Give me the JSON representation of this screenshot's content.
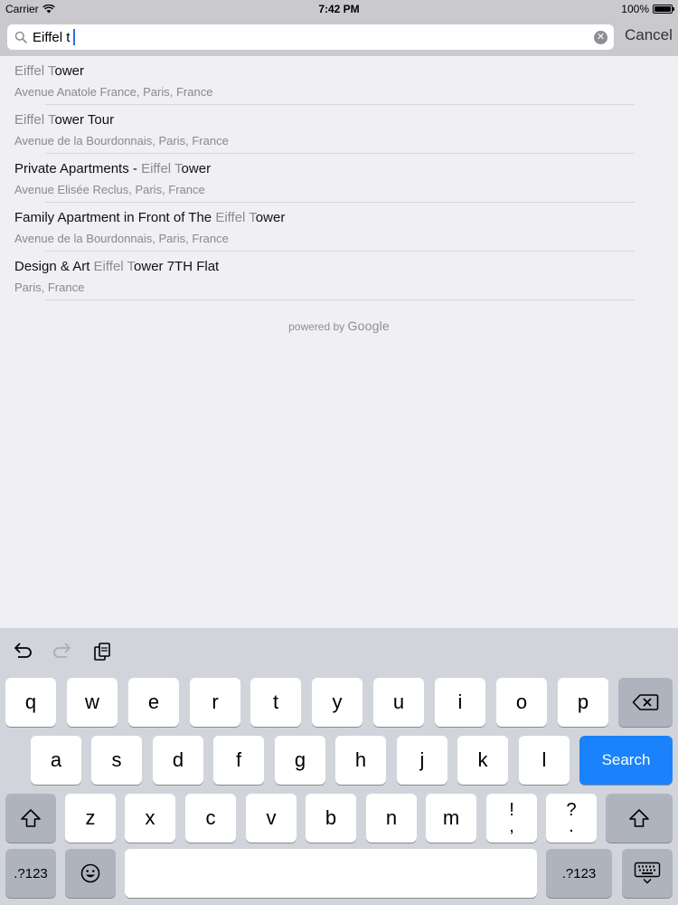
{
  "status": {
    "carrier": "Carrier",
    "time": "7:42 PM",
    "battery": "100%",
    "battery_level": 1.0
  },
  "search": {
    "query": "Eiffel t",
    "cancel_label": "Cancel"
  },
  "results": [
    {
      "title_pre": "",
      "title_match": "Eiffel T",
      "title_post": "ower",
      "subtitle": "Avenue Anatole France, Paris, France"
    },
    {
      "title_pre": "",
      "title_match": "Eiffel T",
      "title_post": "ower Tour",
      "subtitle": "Avenue de la Bourdonnais, Paris, France"
    },
    {
      "title_pre": "Private Apartments - ",
      "title_match": "Eiffel T",
      "title_post": "ower",
      "subtitle": "Avenue Elisée Reclus, Paris, France"
    },
    {
      "title_pre": "Family Apartment in Front of The ",
      "title_match": "Eiffel T",
      "title_post": "ower",
      "subtitle": "Avenue de la Bourdonnais, Paris, France"
    },
    {
      "title_pre": "Design & Art ",
      "title_match": "Eiffel T",
      "title_post": "ower 7TH Flat",
      "subtitle": "Paris, France"
    }
  ],
  "attribution": {
    "prefix": "powered by",
    "brand": "Google"
  },
  "keyboard": {
    "row1": [
      "q",
      "w",
      "e",
      "r",
      "t",
      "y",
      "u",
      "i",
      "o",
      "p"
    ],
    "row2": [
      "a",
      "s",
      "d",
      "f",
      "g",
      "h",
      "j",
      "k",
      "l"
    ],
    "row3": [
      "z",
      "x",
      "c",
      "v",
      "b",
      "n",
      "m"
    ],
    "search_label": "Search",
    "numbers_label": ".?123",
    "punct1_top": "!",
    "punct1_bottom": ",",
    "punct2_top": "?",
    "punct2_bottom": ".",
    "icons": [
      "undo-icon",
      "redo-icon",
      "paste-icon",
      "backspace-icon",
      "shift-icon",
      "emoji-icon",
      "hide-keyboard-icon"
    ]
  }
}
